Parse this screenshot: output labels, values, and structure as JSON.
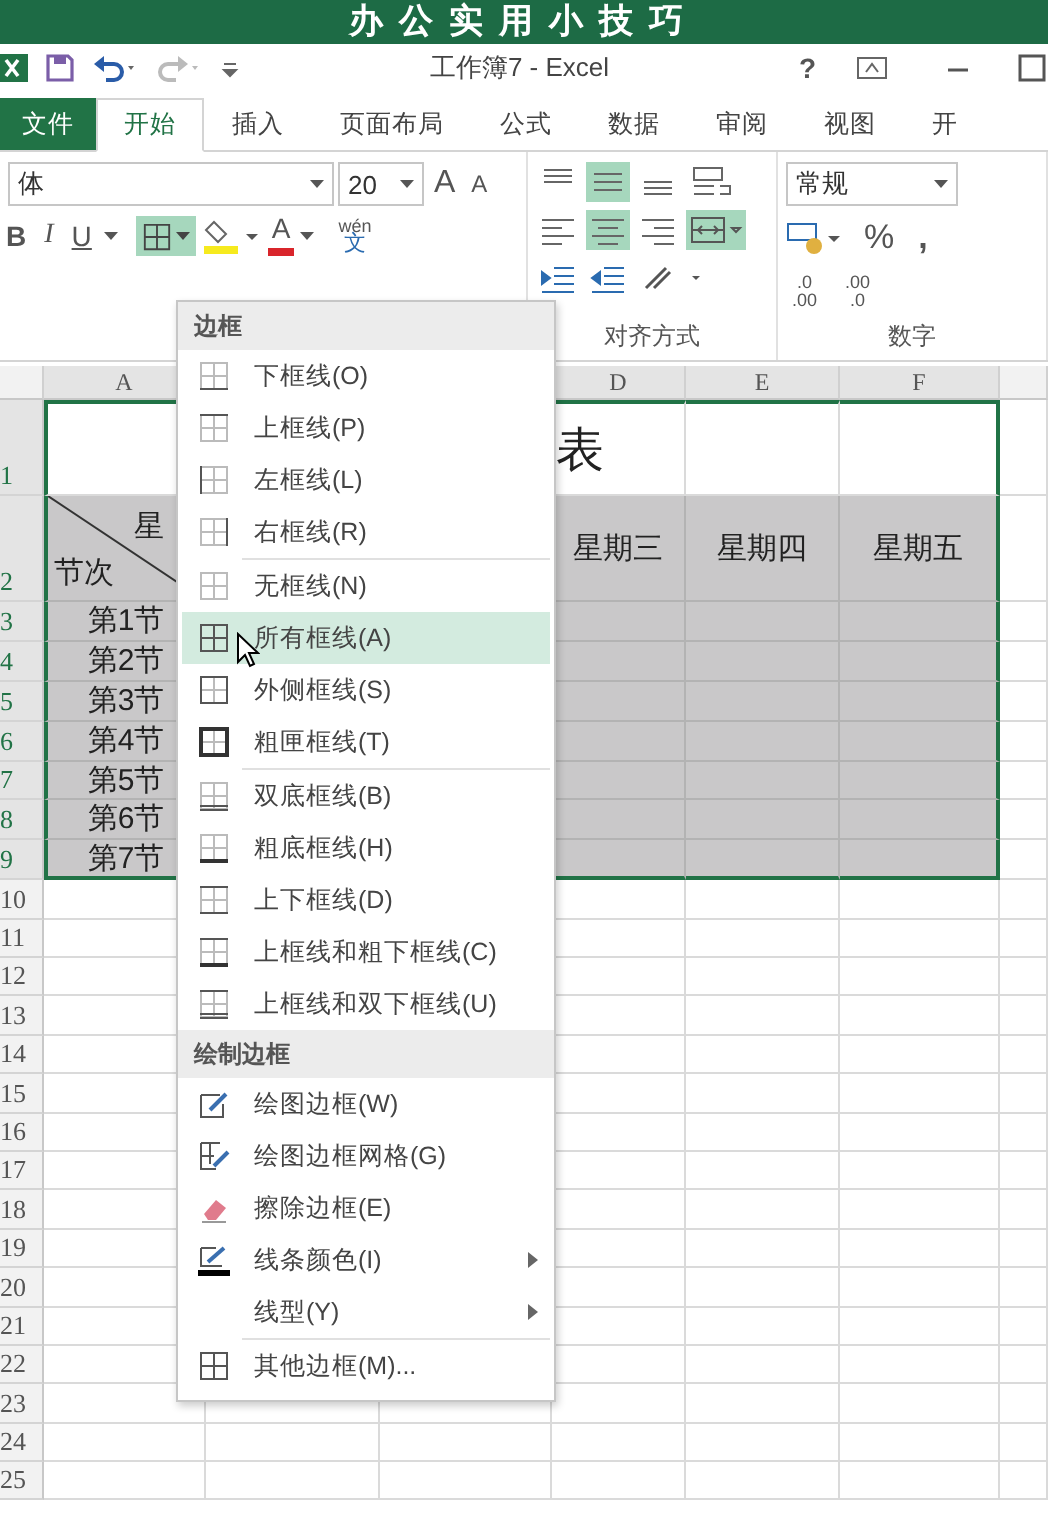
{
  "banner": {
    "title": "办公实用小技巧"
  },
  "titlebar": {
    "title": "工作簿7 - Excel",
    "help": "?"
  },
  "tabs": [
    {
      "label": "文件",
      "kind": "file",
      "selected": false
    },
    {
      "label": "开始",
      "kind": "tab",
      "selected": true
    },
    {
      "label": "插入",
      "kind": "tab",
      "selected": false
    },
    {
      "label": "页面布局",
      "kind": "tab",
      "selected": false
    },
    {
      "label": "公式",
      "kind": "tab",
      "selected": false
    },
    {
      "label": "数据",
      "kind": "tab",
      "selected": false
    },
    {
      "label": "审阅",
      "kind": "tab",
      "selected": false
    },
    {
      "label": "视图",
      "kind": "tab",
      "selected": false
    },
    {
      "label": "开",
      "kind": "tab",
      "selected": false
    }
  ],
  "ribbon": {
    "font": {
      "name": "体",
      "size": "20",
      "grow": "A",
      "shrink": "A",
      "font_color": "A",
      "bold": "B",
      "italic": "I",
      "underline": "U",
      "phonetic": [
        "wén",
        "文"
      ]
    },
    "alignment": {
      "label": "对齐方式"
    },
    "number": {
      "format": "常规",
      "percent": "%",
      "comma": ",",
      "increase_decimal": [
        ".0",
        ".00"
      ],
      "decrease_decimal": [
        ".00",
        ".0"
      ],
      "label": "数字"
    }
  },
  "border_menu": {
    "sections": [
      {
        "title": "边框",
        "items": [
          {
            "label": "下框线(O)",
            "kind": "bottom",
            "selected": false,
            "divider_above": false
          },
          {
            "label": "上框线(P)",
            "kind": "top",
            "selected": false,
            "divider_above": false
          },
          {
            "label": "左框线(L)",
            "kind": "left",
            "selected": false,
            "divider_above": false
          },
          {
            "label": "右框线(R)",
            "kind": "right",
            "selected": false,
            "divider_above": false
          },
          {
            "label": "无框线(N)",
            "kind": "none",
            "selected": false,
            "divider_above": true
          },
          {
            "label": "所有框线(A)",
            "kind": "all",
            "selected": true,
            "divider_above": false
          },
          {
            "label": "外侧框线(S)",
            "kind": "outside",
            "selected": false,
            "divider_above": false
          },
          {
            "label": "粗匣框线(T)",
            "kind": "thick_box",
            "selected": false,
            "divider_above": false
          },
          {
            "label": "双底框线(B)",
            "kind": "double_bottom",
            "selected": false,
            "divider_above": true
          },
          {
            "label": "粗底框线(H)",
            "kind": "thick_bottom",
            "selected": false,
            "divider_above": false
          },
          {
            "label": "上下框线(D)",
            "kind": "top_bottom",
            "selected": false,
            "divider_above": false
          },
          {
            "label": "上框线和粗下框线(C)",
            "kind": "top_thick_bottom",
            "selected": false,
            "divider_above": false
          },
          {
            "label": "上框线和双下框线(U)",
            "kind": "top_double_bottom",
            "selected": false,
            "divider_above": false
          }
        ]
      },
      {
        "title": "绘制边框",
        "items": [
          {
            "label": "绘图边框(W)",
            "kind": "draw",
            "selected": false,
            "divider_above": false
          },
          {
            "label": "绘图边框网格(G)",
            "kind": "draw_grid",
            "selected": false,
            "divider_above": false
          },
          {
            "label": "擦除边框(E)",
            "kind": "erase",
            "selected": false,
            "divider_above": false
          },
          {
            "label": "线条颜色(I)",
            "kind": "line_color",
            "selected": false,
            "divider_above": false,
            "submenu": true
          },
          {
            "label": "线型(Y)",
            "kind": "plain",
            "selected": false,
            "divider_above": false,
            "submenu": true
          },
          {
            "label": "其他边框(M)...",
            "kind": "all",
            "selected": false,
            "divider_above": true
          }
        ]
      }
    ]
  },
  "sheet": {
    "columns": [
      {
        "label": "A",
        "selected": true
      },
      {},
      {},
      {
        "label": "D",
        "selected": true
      },
      {
        "label": "E",
        "selected": true
      },
      {
        "label": "F",
        "selected": true
      },
      {
        "selected": false
      }
    ],
    "rows": [
      {
        "number": "1",
        "selected": true,
        "shaded": false,
        "cells": [
          {},
          {},
          {},
          {
            "text": "表",
            "kind": "title"
          }
        ]
      },
      {
        "number": "2",
        "selected": true,
        "shaded": true,
        "cells": [
          {
            "kind": "diagonal",
            "top": "星",
            "bottom": "节次"
          },
          {},
          {},
          {
            "text": "星期三"
          },
          {
            "text": "星期四"
          },
          {
            "text": "星期五"
          }
        ]
      },
      {
        "number": "3",
        "selected": true,
        "shaded": true,
        "cells": [
          {
            "text": "第1节"
          }
        ]
      },
      {
        "number": "4",
        "selected": true,
        "shaded": true,
        "cells": [
          {
            "text": "第2节"
          }
        ]
      },
      {
        "number": "5",
        "selected": true,
        "shaded": true,
        "cells": [
          {
            "text": "第3节"
          }
        ]
      },
      {
        "number": "6",
        "selected": true,
        "shaded": true,
        "cells": [
          {
            "text": "第4节"
          }
        ]
      },
      {
        "number": "7",
        "selected": true,
        "shaded": true,
        "cells": [
          {
            "text": "第5节"
          }
        ]
      },
      {
        "number": "8",
        "selected": true,
        "shaded": true,
        "cells": [
          {
            "text": "第6节"
          }
        ]
      },
      {
        "number": "9",
        "selected": true,
        "shaded": true,
        "cells": [
          {
            "text": "第7节"
          }
        ]
      },
      {
        "number": "10",
        "selected": false,
        "shaded": false
      },
      {
        "number": "11",
        "selected": false,
        "shaded": false
      },
      {
        "number": "12",
        "selected": false,
        "shaded": false
      },
      {
        "number": "13",
        "selected": false,
        "shaded": false
      },
      {
        "number": "14",
        "selected": false,
        "shaded": false
      },
      {
        "number": "15",
        "selected": false,
        "shaded": false
      },
      {
        "number": "16",
        "selected": false,
        "shaded": false
      },
      {
        "number": "17",
        "selected": false,
        "shaded": false
      },
      {
        "number": "18",
        "selected": false,
        "shaded": false
      },
      {
        "number": "19",
        "selected": false,
        "shaded": false
      },
      {
        "number": "20",
        "selected": false,
        "shaded": false
      },
      {
        "number": "21",
        "selected": false,
        "shaded": false
      },
      {
        "number": "22",
        "selected": false,
        "shaded": false
      },
      {
        "number": "23",
        "selected": false,
        "shaded": false
      },
      {
        "number": "24",
        "selected": false,
        "shaded": false
      },
      {
        "number": "25",
        "selected": false,
        "shaded": false
      }
    ]
  }
}
